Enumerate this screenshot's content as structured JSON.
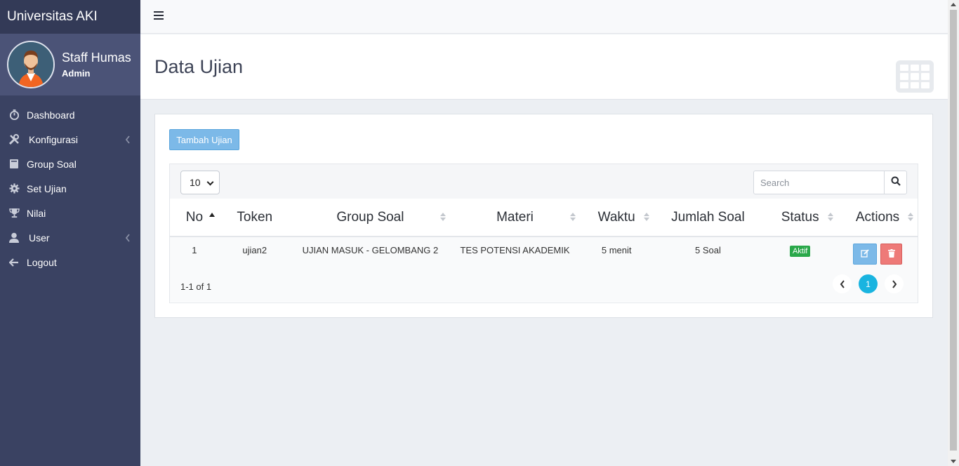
{
  "app": {
    "brand": "Universitas AKI"
  },
  "user": {
    "name": "Staff Humas",
    "role": "Admin"
  },
  "sidebar": {
    "items": [
      {
        "label": "Dashboard",
        "icon": "stopwatch-icon"
      },
      {
        "label": "Konfigurasi",
        "icon": "tools-icon",
        "has_submenu": true
      },
      {
        "label": "Group Soal",
        "icon": "book-icon"
      },
      {
        "label": "Set Ujian",
        "icon": "gear-icon"
      },
      {
        "label": "Nilai",
        "icon": "trophy-icon"
      },
      {
        "label": "User",
        "icon": "user-icon",
        "has_submenu": true
      },
      {
        "label": "Logout",
        "icon": "arrow-left-icon"
      }
    ]
  },
  "page": {
    "title": "Data Ujian"
  },
  "toolbar": {
    "add_label": "Tambah Ujian"
  },
  "table": {
    "per_page": "10",
    "search_placeholder": "Search",
    "columns": [
      "No",
      "Token",
      "Group Soal",
      "Materi",
      "Waktu",
      "Jumlah Soal",
      "Status",
      "Actions"
    ],
    "sorted_column": "No",
    "sort_direction": "ascending",
    "rows": [
      {
        "no": "1",
        "token": "ujian2",
        "group_soal": "UJIAN MASUK - GELOMBANG 2",
        "materi": "TES POTENSI AKADEMIK",
        "waktu": "5 menit",
        "jumlah_soal": "5 Soal",
        "status": "Aktif"
      }
    ],
    "page_info": "1-1 of 1",
    "current_page": "1"
  },
  "colors": {
    "sidebar_bg": "#3a4262",
    "brand_bg": "#333a57",
    "accent_blue": "#7cb9e8",
    "danger_red": "#ee7a78",
    "status_green": "#2aa84a",
    "pager_active": "#19b4e0"
  }
}
